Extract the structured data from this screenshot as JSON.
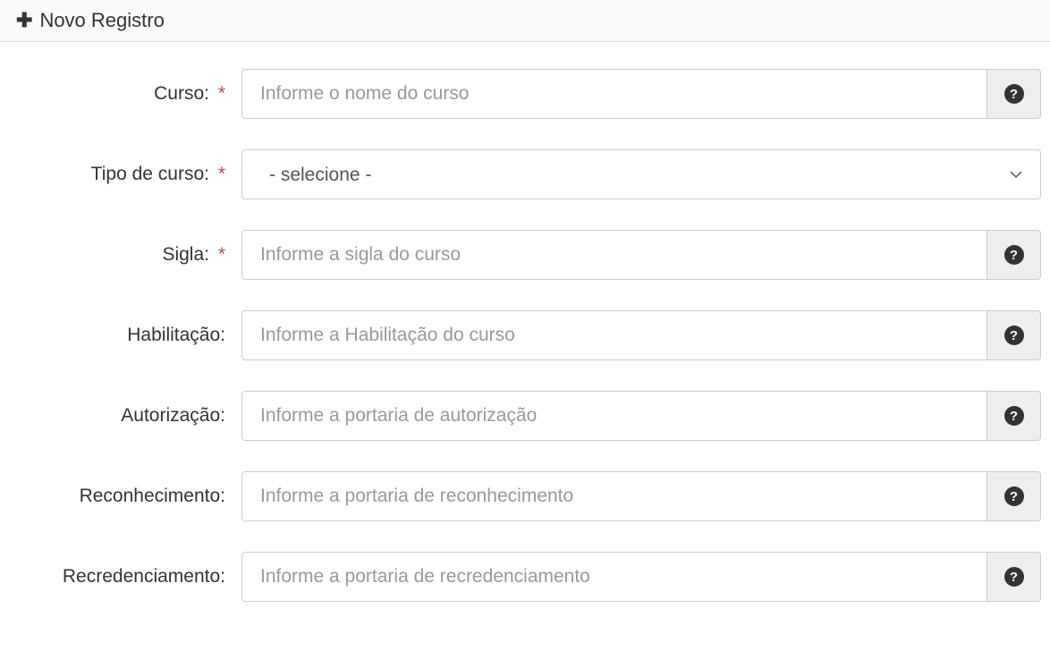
{
  "header": {
    "title": "Novo Registro"
  },
  "form": {
    "curso": {
      "label": "Curso:",
      "required_mark": "*",
      "placeholder": "Informe o nome do curso"
    },
    "tipo_curso": {
      "label": "Tipo de curso:",
      "required_mark": "*",
      "selected": "- selecione -"
    },
    "sigla": {
      "label": "Sigla:",
      "required_mark": "*",
      "placeholder": "Informe a sigla do curso"
    },
    "habilitacao": {
      "label": "Habilitação:",
      "placeholder": "Informe a Habilitação do curso"
    },
    "autorizacao": {
      "label": "Autorização:",
      "placeholder": "Informe a portaria de autorização"
    },
    "reconhecimento": {
      "label": "Reconhecimento:",
      "placeholder": "Informe a portaria de reconhecimento"
    },
    "recredenciamento": {
      "label": "Recredenciamento:",
      "placeholder": "Informe a portaria de recredenciamento"
    }
  },
  "help_glyph": "?"
}
